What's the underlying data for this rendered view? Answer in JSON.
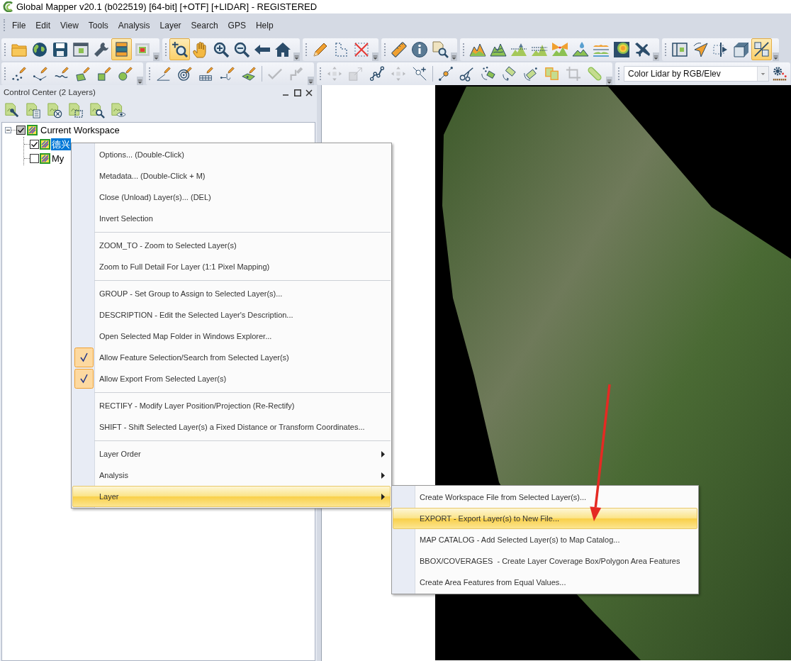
{
  "window": {
    "title": "Global Mapper v20.1 (b022519) [64-bit] [+OTF] [+LIDAR] - REGISTERED"
  },
  "menu_bar": [
    "File",
    "Edit",
    "View",
    "Tools",
    "Analysis",
    "Layer",
    "Search",
    "GPS",
    "Help"
  ],
  "toolbar_rows": [
    {
      "groups": [
        {
          "buttons": [
            {
              "selected": false,
              "disabled": false
            },
            {
              "selected": false,
              "disabled": false
            },
            {
              "selected": false,
              "disabled": false
            },
            {
              "selected": false,
              "disabled": false
            },
            {
              "selected": false,
              "disabled": false
            },
            {
              "selected": true,
              "disabled": false
            },
            {
              "selected": false,
              "disabled": false
            }
          ]
        },
        {
          "buttons": [
            {
              "selected": true,
              "disabled": false
            },
            {
              "selected": false,
              "disabled": false
            },
            {
              "selected": false,
              "disabled": false
            },
            {
              "selected": false,
              "disabled": false
            },
            {
              "selected": false,
              "disabled": false
            },
            {
              "selected": false,
              "disabled": false
            }
          ]
        },
        {
          "buttons": [
            {
              "selected": false,
              "disabled": false
            },
            {
              "selected": false,
              "disabled": false
            },
            {
              "selected": false,
              "disabled": false
            }
          ]
        },
        {
          "buttons": [
            {
              "selected": false,
              "disabled": false
            },
            {
              "selected": false,
              "disabled": false
            },
            {
              "selected": false,
              "disabled": false
            }
          ]
        },
        {
          "buttons": [
            {
              "selected": false,
              "disabled": false
            },
            {
              "selected": false,
              "disabled": false
            },
            {
              "selected": false,
              "disabled": false
            },
            {
              "selected": false,
              "disabled": false
            },
            {
              "selected": false,
              "disabled": false
            },
            {
              "selected": false,
              "disabled": false
            },
            {
              "selected": false,
              "disabled": false
            },
            {
              "selected": false,
              "disabled": false
            },
            {
              "selected": false,
              "disabled": false
            }
          ]
        },
        {
          "buttons": [
            {
              "selected": false,
              "disabled": false
            },
            {
              "selected": false,
              "disabled": false
            },
            {
              "selected": false,
              "disabled": false
            },
            {
              "selected": false,
              "disabled": false
            },
            {
              "selected": true,
              "disabled": false
            }
          ]
        }
      ]
    },
    {
      "groups": [
        {
          "buttons": [
            {
              "selected": false,
              "disabled": false
            },
            {
              "selected": false,
              "disabled": false
            },
            {
              "selected": false,
              "disabled": false
            },
            {
              "selected": false,
              "disabled": false
            },
            {
              "selected": false,
              "disabled": false
            },
            {
              "selected": false,
              "disabled": false
            }
          ]
        },
        {
          "buttons": [
            {
              "selected": false,
              "disabled": false
            },
            {
              "selected": false,
              "disabled": false
            },
            {
              "selected": false,
              "disabled": false
            },
            {
              "selected": false,
              "disabled": false
            },
            {
              "selected": false,
              "disabled": false
            },
            {
              "selected": false,
              "disabled": true
            },
            {
              "selected": false,
              "disabled": true
            }
          ]
        },
        {
          "buttons": [
            {
              "selected": false,
              "disabled": true
            },
            {
              "selected": false,
              "disabled": true
            },
            {
              "selected": false,
              "disabled": false
            },
            {
              "selected": false,
              "disabled": true
            },
            {
              "selected": false,
              "disabled": false
            },
            {
              "selected": false,
              "disabled": false
            },
            {
              "selected": false,
              "disabled": false
            },
            {
              "selected": false,
              "disabled": false
            },
            {
              "selected": false,
              "disabled": false
            },
            {
              "selected": false,
              "disabled": false
            },
            {
              "selected": false,
              "disabled": false
            },
            {
              "selected": false,
              "disabled": true
            },
            {
              "selected": false,
              "disabled": false
            }
          ]
        },
        {
          "dropdown": {
            "value": "Color Lidar by RGB/Elev"
          },
          "buttons": [
            {
              "selected": false,
              "disabled": false
            }
          ]
        }
      ]
    }
  ],
  "control_center": {
    "title": "Control Center (2 Layers)",
    "tree": [
      {
        "label": "Current Workspace",
        "checked": true,
        "expanded": true,
        "selected": false,
        "children": [
          {
            "label": "德兴",
            "checked": true,
            "selected": true
          },
          {
            "label": "My",
            "checked": false,
            "selected": false
          }
        ]
      }
    ]
  },
  "context_menu": {
    "sections": [
      [
        {
          "label": "Options... (Double-Click)",
          "checked": false,
          "submenu": false,
          "selected": false
        },
        {
          "label": "Metadata... (Double-Click + M)",
          "checked": false,
          "submenu": false,
          "selected": false
        },
        {
          "label": "Close (Unload) Layer(s)... (DEL)",
          "checked": false,
          "submenu": false,
          "selected": false
        },
        {
          "label": "Invert Selection",
          "checked": false,
          "submenu": false,
          "selected": false
        }
      ],
      [
        {
          "label": "ZOOM_TO - Zoom to Selected Layer(s)",
          "checked": false,
          "submenu": false,
          "selected": false
        },
        {
          "label": "Zoom to Full Detail For Layer (1:1 Pixel Mapping)",
          "checked": false,
          "submenu": false,
          "selected": false
        }
      ],
      [
        {
          "label": "GROUP - Set Group to Assign to Selected Layer(s)...",
          "checked": false,
          "submenu": false,
          "selected": false
        },
        {
          "label": "DESCRIPTION - Edit the Selected Layer's Description...",
          "checked": false,
          "submenu": false,
          "selected": false
        },
        {
          "label": "Open Selected Map Folder in Windows Explorer...",
          "checked": false,
          "submenu": false,
          "selected": false
        },
        {
          "label": "Allow Feature Selection/Search from Selected Layer(s)",
          "checked": true,
          "submenu": false,
          "selected": false
        },
        {
          "label": "Allow Export From Selected Layer(s)",
          "checked": true,
          "submenu": false,
          "selected": false
        }
      ],
      [
        {
          "label": "RECTIFY - Modify Layer Position/Projection (Re-Rectify)",
          "checked": false,
          "submenu": false,
          "selected": false
        },
        {
          "label": "SHIFT - Shift Selected Layer(s) a Fixed Distance or Transform Coordinates...",
          "checked": false,
          "submenu": false,
          "selected": false
        }
      ],
      [
        {
          "label": "Layer Order",
          "checked": false,
          "submenu": true,
          "selected": false
        },
        {
          "label": "Analysis",
          "checked": false,
          "submenu": true,
          "selected": false
        },
        {
          "label": "Layer",
          "checked": false,
          "submenu": true,
          "selected": true
        }
      ]
    ]
  },
  "layer_submenu": {
    "items": [
      {
        "label": "Create Workspace File from Selected Layer(s)...",
        "selected": false
      },
      {
        "label": "EXPORT - Export Layer(s) to New File...",
        "selected": true
      },
      {
        "label": "MAP CATALOG - Add Selected Layer(s) to Map Catalog...",
        "selected": false
      },
      {
        "label": "BBOX/COVERAGES  - Create Layer Coverage Box/Polygon Area Features",
        "selected": false
      },
      {
        "label": "Create Area Features from Equal Values...",
        "selected": false
      }
    ]
  }
}
